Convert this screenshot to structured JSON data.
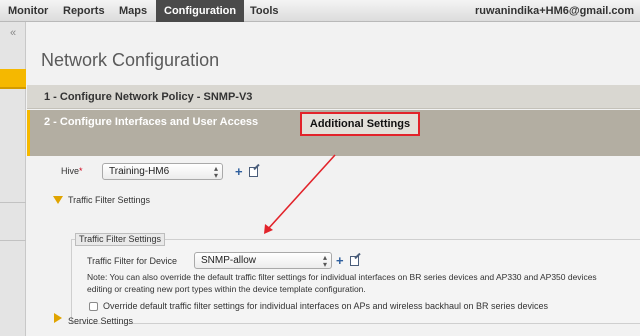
{
  "menu": {
    "tabs": [
      {
        "label": "Monitor",
        "active": false
      },
      {
        "label": "Reports",
        "active": false
      },
      {
        "label": "Maps",
        "active": false
      },
      {
        "label": "Configuration",
        "active": true
      },
      {
        "label": "Tools",
        "active": false
      }
    ],
    "user": "ruwanindika+HM6@gmail.com"
  },
  "sidebar": {
    "collapse_icon": "double-chevron-left-icon",
    "collapse_glyph": "«"
  },
  "page": {
    "title": "Network Configuration"
  },
  "steps": [
    {
      "label": "1 - Configure Network Policy - SNMP-V3"
    },
    {
      "label": "2 - Configure Interfaces and User Access"
    }
  ],
  "annotation": {
    "callout": "Additional Settings",
    "color": "#e2232a"
  },
  "hive": {
    "label": "Hive",
    "required_mark": "*",
    "value": "Training-HM6"
  },
  "traffic_filter_section": {
    "label": "Traffic Filter Settings",
    "expanded": true
  },
  "traffic_filter_group": {
    "legend": "Traffic Filter Settings",
    "field_label": "Traffic Filter for Device",
    "value": "SNMP-allow",
    "note_line1": "Note: You can also override the default traffic filter settings for individual interfaces on BR series devices and AP330 and AP350 devices",
    "note_line2": "editing or creating new port types within the device template configuration.",
    "override_label": "Override default traffic filter settings for individual interfaces on APs and wireless backhaul on BR series devices",
    "override_checked": false
  },
  "service_section": {
    "label": "Service Settings",
    "expanded": false
  },
  "colors": {
    "accent": "#f5b800",
    "active_tab": "#4a4a4a",
    "step2_background": "#b3aea2",
    "icon_blue": "#2f5f9e"
  }
}
